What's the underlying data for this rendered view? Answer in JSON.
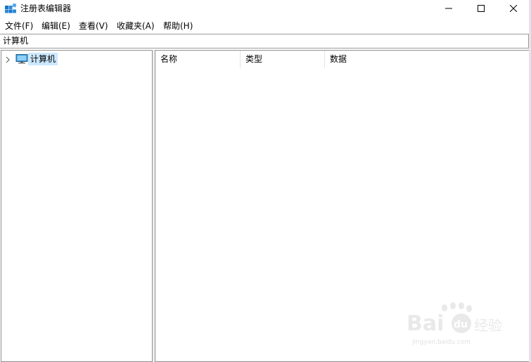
{
  "window": {
    "title": "注册表编辑器",
    "icon": "registry-editor-icon"
  },
  "menu": [
    {
      "label": "文件(F)"
    },
    {
      "label": "编辑(E)"
    },
    {
      "label": "查看(V)"
    },
    {
      "label": "收藏夹(A)"
    },
    {
      "label": "帮助(H)"
    }
  ],
  "address": {
    "path": "计算机"
  },
  "tree": {
    "root_label": "计算机",
    "root_icon": "computer-icon",
    "selected_bg": "#cce8ff"
  },
  "list": {
    "columns": [
      "名称",
      "类型",
      "数据"
    ]
  },
  "watermark": {
    "brand": "Bai du 经验",
    "url": "jingyan.baidu.com"
  }
}
